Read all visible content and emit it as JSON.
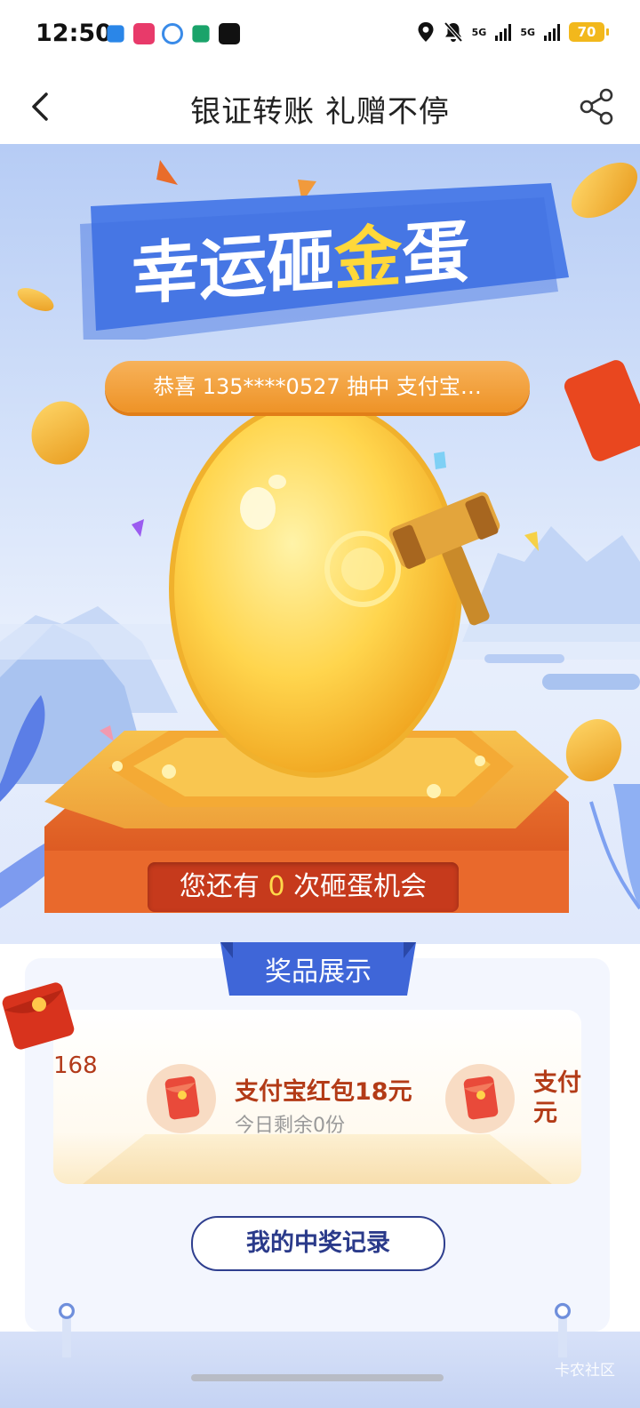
{
  "status_bar": {
    "time": "12:50",
    "network_1": "5G",
    "network_2": "5G",
    "battery": "70",
    "battery_color": "#f2b81c"
  },
  "nav": {
    "title": "银证转账 礼赠不停",
    "back_icon": "chevron-left-icon",
    "share_icon": "share-icon"
  },
  "hero": {
    "banner_title_part1": "幸运砸",
    "banner_title_highlight": "金",
    "banner_title_part2": "蛋",
    "winner_ticker": "恭喜 135****0527 抽中 支付宝…",
    "chances_prefix": "您还有 ",
    "chances_count": "0",
    "chances_suffix": " 次砸蛋机会"
  },
  "prizes": {
    "section_title": "奖品展示",
    "partial_left_text": "168",
    "items": [
      {
        "name": "支付宝红包18元",
        "remaining": "今日剩余0份",
        "icon": "red-envelope-icon"
      }
    ],
    "partial_right_line1": "支付",
    "partial_right_line2": "元"
  },
  "actions": {
    "records_label": "我的中奖记录"
  },
  "watermark": "卡农社区"
}
